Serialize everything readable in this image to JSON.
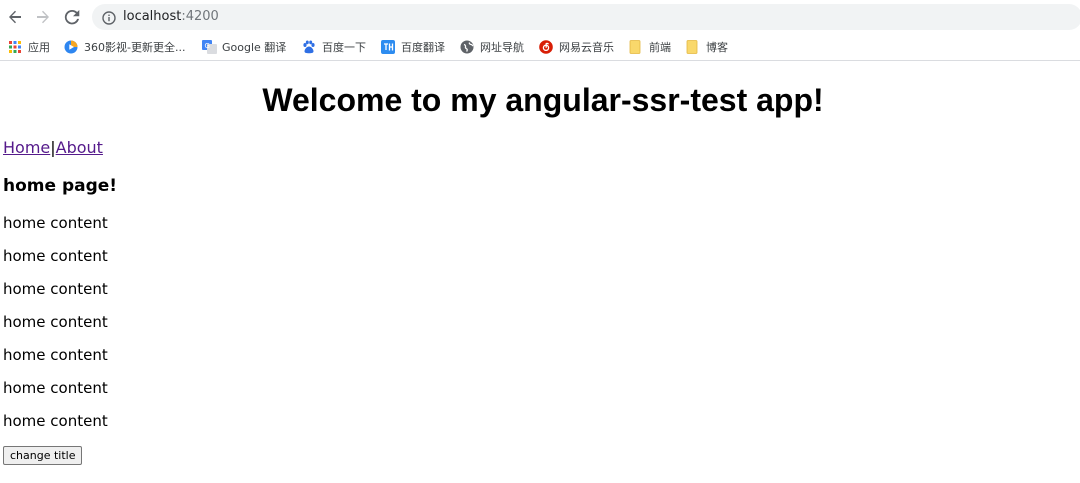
{
  "browser": {
    "url_host": "localhost",
    "url_port": ":4200",
    "bookmarks": [
      {
        "label": "应用",
        "icon": "apps-grid-icon"
      },
      {
        "label": "360影视-更新更全...",
        "icon": "video-play-icon"
      },
      {
        "label": "Google 翻译",
        "icon": "google-translate-icon"
      },
      {
        "label": "百度一下",
        "icon": "baidu-paw-icon"
      },
      {
        "label": "百度翻译",
        "icon": "baidu-translate-icon"
      },
      {
        "label": "网址导航",
        "icon": "globe-icon"
      },
      {
        "label": "网易云音乐",
        "icon": "netease-music-icon"
      },
      {
        "label": "前端",
        "icon": "folder-icon"
      },
      {
        "label": "博客",
        "icon": "folder-icon"
      }
    ]
  },
  "page": {
    "title": "Welcome to my angular-ssr-test app!",
    "nav": {
      "home": "Home",
      "separator": "|",
      "about": "About"
    },
    "heading": "home page!",
    "content_lines": [
      "home content",
      "home content",
      "home content",
      "home content",
      "home content",
      "home content",
      "home content"
    ],
    "button_label": "change title"
  },
  "colors": {
    "link_visited": "#551a8b",
    "omnibox_bg": "#f1f3f4",
    "folder_yellow": "#f9d86b"
  }
}
